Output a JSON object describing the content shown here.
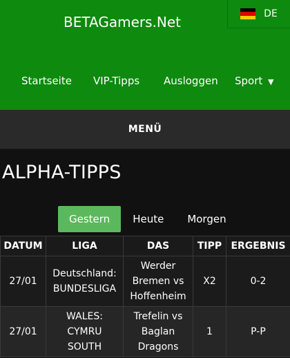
{
  "header": {
    "brand": "BETAGamers.Net",
    "language": {
      "code": "DE",
      "flag_colors": [
        "#000000",
        "#dd0000",
        "#ffcc00"
      ]
    },
    "nav": [
      {
        "label": "Startseite"
      },
      {
        "label": "VIP-Tipps"
      },
      {
        "label": "Ausloggen"
      },
      {
        "label": "Sport"
      }
    ]
  },
  "menu": {
    "label": "MENÜ"
  },
  "main": {
    "title": "ALPHA-TIPPS",
    "tabs": [
      {
        "label": "Gestern",
        "active": true
      },
      {
        "label": "Heute",
        "active": false
      },
      {
        "label": "Morgen",
        "active": false
      }
    ],
    "table": {
      "columns": [
        "DATUM",
        "LIGA",
        "DAS",
        "TIPP",
        "ERGEBNIS"
      ],
      "rows": [
        {
          "datum": "27/01",
          "liga": [
            "Deutschland:",
            "BUNDESLIGA"
          ],
          "das": [
            "Werder",
            "Bremen vs",
            "Hoffenheim"
          ],
          "tipp": "X2",
          "ergebnis": "0-2"
        },
        {
          "datum": "27/01",
          "liga": [
            "WALES:",
            "CYMRU",
            "SOUTH"
          ],
          "das": [
            "Trefelin vs",
            "Baglan",
            "Dragons"
          ],
          "tipp": "1",
          "ergebnis": "P-P"
        }
      ]
    }
  },
  "colors": {
    "header_green": "#0e8a0e",
    "active_tab": "#5cb85c",
    "background": "#111111",
    "menu_bar": "#2a2a2a"
  }
}
